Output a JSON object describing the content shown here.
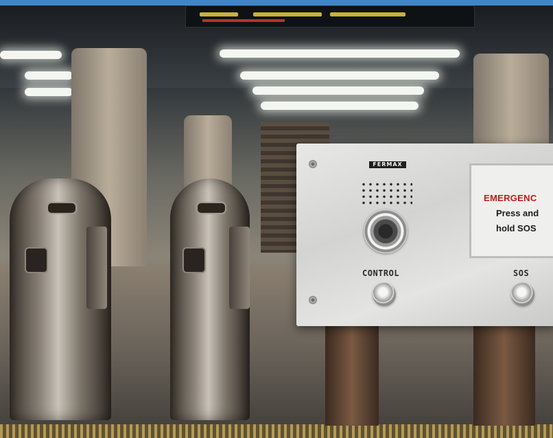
{
  "panel": {
    "brand": "FERMAX",
    "display": {
      "line1": "EMERGENC",
      "line2": "Press and",
      "line3": "hold SOS"
    },
    "control_label": "CONTROL",
    "sos_label": "SOS"
  },
  "colors": {
    "top_bar": "#3f86c9",
    "emergency_text": "#c41a1a"
  }
}
